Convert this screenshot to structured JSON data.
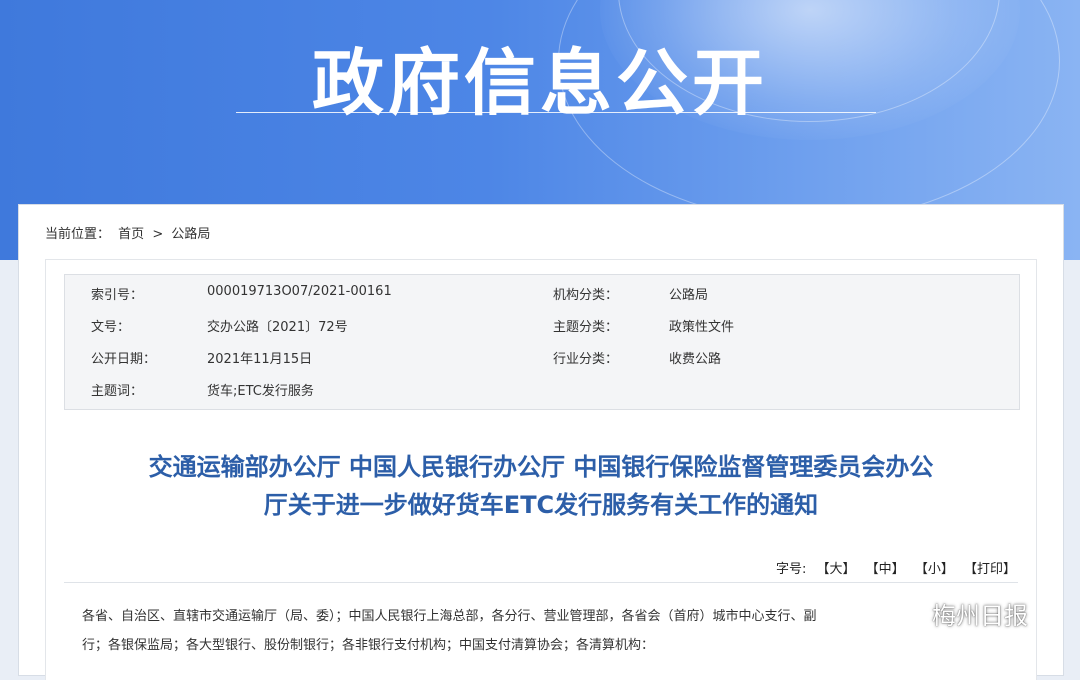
{
  "banner": {
    "title": "政府信息公开"
  },
  "breadcrumb": {
    "prefix": "当前位置：",
    "home": "首页",
    "separator": ">",
    "current": "公路局"
  },
  "meta": {
    "rows": [
      {
        "label1": "索引号：",
        "value1": "000019713O07/2021-00161",
        "label2": "机构分类：",
        "value2": "公路局"
      },
      {
        "label1": "文号：",
        "value1": "交办公路〔2021〕72号",
        "label2": "主题分类：",
        "value2": "政策性文件"
      },
      {
        "label1": "公开日期：",
        "value1": "2021年11月15日",
        "label2": "行业分类：",
        "value2": "收费公路"
      },
      {
        "label1": "主题词：",
        "value1": "货车;ETC发行服务",
        "label2": "",
        "value2": ""
      }
    ]
  },
  "document": {
    "title_line1": "交通运输部办公厅 中国人民银行办公厅 中国银行保险监督管理委员会办公",
    "title_line2": "厅关于进一步做好货车ETC发行服务有关工作的通知"
  },
  "font_tools": {
    "label": "字号:",
    "large": "【大】",
    "medium": "【中】",
    "small": "【小】",
    "print": "【打印】"
  },
  "body": {
    "line1": "各省、自治区、直辖市交通运输厅（局、委）；中国人民银行上海总部，各分行、营业管理部，各省会（首府）城市中心支行、副",
    "line2": "行；各银保监局；各大型银行、股份制银行；各非银行支付机构；中国支付清算协会；各清算机构："
  },
  "watermark": {
    "text": "梅州日报",
    "icon": "wechat-icon"
  }
}
